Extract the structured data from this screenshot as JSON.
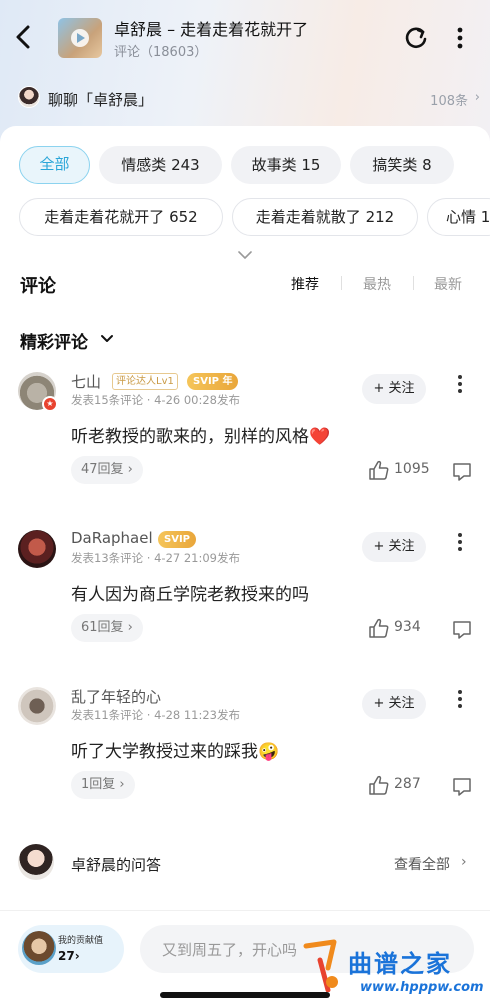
{
  "header": {
    "title": "卓舒晨 – 走着走着花就开了",
    "subtitle": "评论（18603）"
  },
  "chat": {
    "label": "聊聊「卓舒晨」",
    "count": "108条",
    "arrow": "›"
  },
  "tags": [
    {
      "label": "全部",
      "active": true
    },
    {
      "label": "情感类 243"
    },
    {
      "label": "故事类 15"
    },
    {
      "label": "搞笑类 8"
    },
    {
      "label": "走着走着花就开了 652"
    },
    {
      "label": "走着走着就散了 212"
    },
    {
      "label": "心情 1"
    }
  ],
  "comments_section": {
    "title": "评论",
    "sort_tabs": [
      "推荐",
      "最热",
      "最新"
    ],
    "featured_label": "精彩评论"
  },
  "follow_label": "+ 关注",
  "comments": [
    {
      "name": "七山",
      "badge_level": "评论达人Lv1",
      "badge_svip": "SVIP 年",
      "meta": "发表15条评论 · 4-26 00:28发布",
      "text": "听老教授的歌来的，别样的风格❤️",
      "replies": "47回复 ›",
      "likes": "1095"
    },
    {
      "name": "DaRaphael",
      "badge_svip": "SVIP",
      "meta": "发表13条评论 · 4-27 21:09发布",
      "text": "有人因为商丘学院老教授来的吗",
      "replies": "61回复 ›",
      "likes": "934"
    },
    {
      "name": "乱了年轻的心",
      "meta": "发表11条评论 · 4-28 11:23发布",
      "text": "听了大学教授过来的踩我🤪",
      "replies": "1回复 ›",
      "likes": "287"
    }
  ],
  "qa": {
    "title": "卓舒晨的问答",
    "view_all": "查看全部",
    "arrow": "›"
  },
  "bottom": {
    "contrib_label": "我的贡献值",
    "contrib_value": "27›",
    "input_placeholder": "又到周五了，开心吗"
  },
  "watermark": {
    "name": "曲谱之家",
    "url": "www.hpppw.com"
  },
  "colors": {
    "accent": "#2aa6d8",
    "heart": "#e8432f",
    "svip": "#e9a63a"
  }
}
